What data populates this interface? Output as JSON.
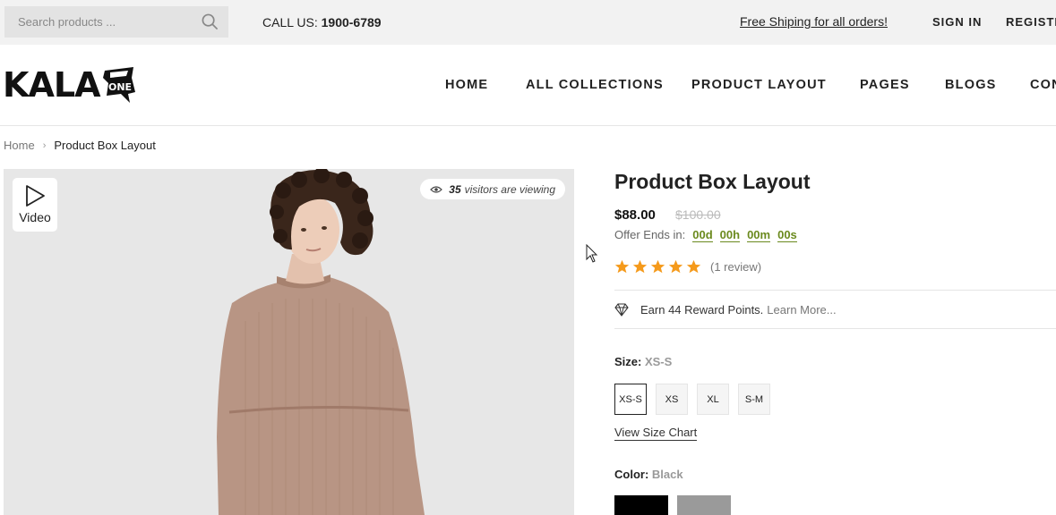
{
  "topbar": {
    "search_placeholder": "Search products ...",
    "call_prefix": "CALL US:",
    "call_number": "1900-6789",
    "shipping": "Free Shiping for all orders!",
    "sign_in": "SIGN IN",
    "register": "REGISTER"
  },
  "header": {
    "logo_text": "KALA",
    "logo_badge": "ONE",
    "nav": [
      "HOME",
      "ALL COLLECTIONS",
      "PRODUCT LAYOUT",
      "PAGES",
      "BLOGS",
      "CONTACT"
    ]
  },
  "breadcrumb": {
    "home": "Home",
    "current": "Product Box Layout"
  },
  "gallery": {
    "video_label": "Video",
    "viewers_count": "35",
    "viewers_text": "visitors are viewing"
  },
  "product": {
    "title": "Product Box Layout",
    "price": "$88.00",
    "old_price": "$100.00",
    "offer_label": "Offer Ends in:",
    "countdown": [
      "00d",
      "00h",
      "00m",
      "00s"
    ],
    "rating": 5,
    "review_text": "(1 review)",
    "reward_text": "Earn 44 Reward Points.",
    "reward_link": "Learn More...",
    "size_label": "Size:",
    "size_selected": "XS-S",
    "sizes": [
      "XS-S",
      "XS",
      "XL",
      "S-M"
    ],
    "size_chart": "View Size Chart",
    "color_label": "Color:",
    "color_selected": "Black",
    "colors": [
      "#000000",
      "#9a9a9a"
    ]
  },
  "colors": {
    "accent_star": "#f59a1b",
    "countdown": "#6b8a1e"
  }
}
